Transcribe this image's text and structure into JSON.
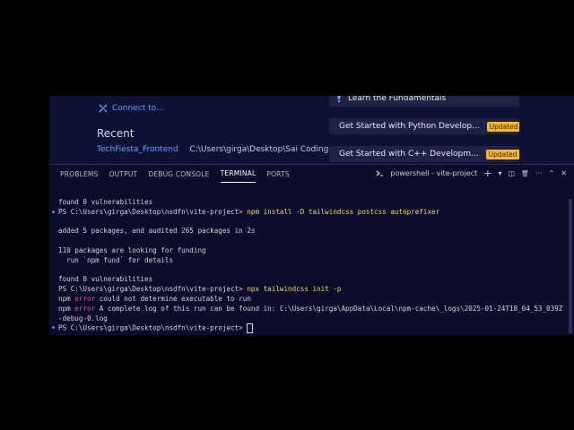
{
  "welcome": {
    "connect_label": "Connect to...",
    "recent_title": "Recent",
    "recent_items": [
      {
        "name": "TechFiesta_Frontend",
        "path": "C:\\Users\\girga\\Desktop\\Sai Coding"
      }
    ],
    "walkthroughs": [
      {
        "label": "Learn the Fundamentals",
        "badge": ""
      },
      {
        "label": "Get Started with Python Develop...",
        "badge": "Updated"
      },
      {
        "label": "Get Started with C++ Developm...",
        "badge": "Updated"
      }
    ]
  },
  "panel": {
    "tabs": [
      "PROBLEMS",
      "OUTPUT",
      "DEBUG CONSOLE",
      "TERMINAL",
      "PORTS"
    ],
    "active_tab": "TERMINAL",
    "shell_label": "powershell - vite-project",
    "tool_glyphs": {
      "add": "+",
      "dropdown": "▾",
      "split": "◫",
      "trash": "🗑",
      "more": "···",
      "maximize": "⌃",
      "close": "✕"
    }
  },
  "terminal": {
    "lines": [
      {
        "text": "found 0 vulnerabilities",
        "kind": "plain"
      },
      {
        "prompt": "PS C:\\Users\\girga\\Desktop\\nsdfn\\vite-project> ",
        "cmd": "npm install -D tailwindcss postcss autoprefixer",
        "kind": "prompt",
        "dot": true
      },
      {
        "text": "",
        "kind": "plain"
      },
      {
        "text": "added 5 packages, and audited 265 packages in 2s",
        "kind": "plain"
      },
      {
        "text": "",
        "kind": "plain"
      },
      {
        "text": "110 packages are looking for funding",
        "kind": "plain"
      },
      {
        "text": "  run `npm fund` for details",
        "kind": "plain"
      },
      {
        "text": "",
        "kind": "plain"
      },
      {
        "text": "found 0 vulnerabilities",
        "kind": "plain"
      },
      {
        "prompt": "PS C:\\Users\\girga\\Desktop\\nsdfn\\vite-project> ",
        "cmd": "npx tailwindcss init -p",
        "kind": "prompt"
      },
      {
        "tag": "npm ",
        "err": "error",
        "text": " could not determine executable to run",
        "kind": "error"
      },
      {
        "tag": "npm ",
        "err": "error",
        "text": " A complete log of this run can be found in: C:\\Users\\girga\\AppData\\Local\\npm-cache\\_logs\\2025-01-24T18_04_53_039Z",
        "kind": "error"
      },
      {
        "text": "-debug-0.log",
        "kind": "plain"
      },
      {
        "prompt": "PS C:\\Users\\girga\\Desktop\\nsdfn\\vite-project> ",
        "cmd": "",
        "kind": "prompt",
        "cursor": true,
        "dot": true
      }
    ]
  },
  "colors": {
    "welcome_bg": "#0f1035",
    "panel_bg": "#0b0c2a",
    "link": "#5aa7ff",
    "command": "#f0d86e",
    "error": "#e05f70",
    "badge": "#f2b83a"
  }
}
